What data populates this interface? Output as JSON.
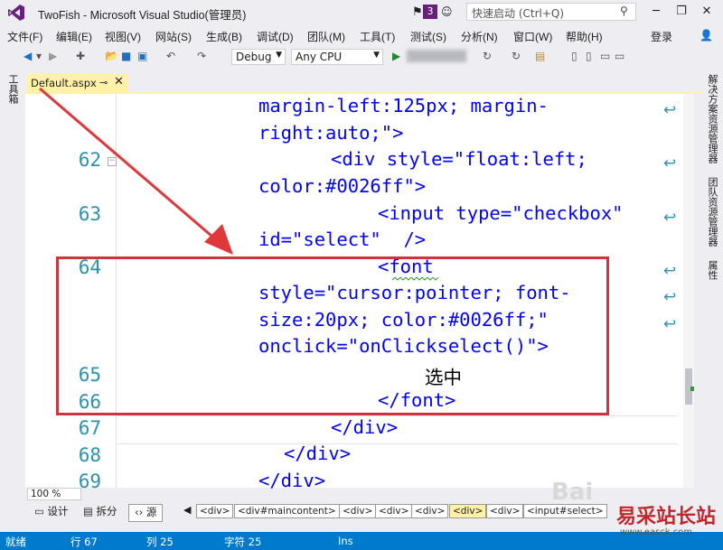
{
  "window": {
    "title": "TwoFish - Microsoft Visual Studio(管理员)",
    "notification_count": "3",
    "quick_launch_placeholder": "快速启动 (Ctrl+Q)",
    "login": "登录",
    "controls": [
      "─",
      "❐",
      "✕"
    ]
  },
  "menu": [
    "文件(F)",
    "编辑(E)",
    "视图(V)",
    "网站(S)",
    "生成(B)",
    "调试(D)",
    "团队(M)",
    "工具(T)",
    "测试(S)",
    "分析(N)",
    "窗口(W)",
    "帮助(H)"
  ],
  "toolbar": {
    "config": "Debug",
    "platform": "Any CPU"
  },
  "left_panel": {
    "toolbox": "工具箱"
  },
  "right_panel": [
    "解决方案资源管理器",
    "团队资源管理器",
    "属性"
  ],
  "document_tab": {
    "label": "Default.aspx",
    "pin": "ᵖ",
    "close": "✕"
  },
  "editor": {
    "lines": [
      {
        "num": "",
        "text": "margin-left:125px; margin-"
      },
      {
        "num": "",
        "text": "right:auto;\">"
      },
      {
        "num": "62",
        "text": "<div style=\"float:left;"
      },
      {
        "num": "",
        "text": "color:#0026ff\">"
      },
      {
        "num": "63",
        "text": "<input type=\"checkbox\""
      },
      {
        "num": "",
        "text": "id=\"select\"  />"
      },
      {
        "num": "64",
        "text": "<font"
      },
      {
        "num": "",
        "text": "style=\"cursor:pointer; font-"
      },
      {
        "num": "",
        "text": "size:20px; color:#0026ff;\""
      },
      {
        "num": "",
        "text": "onclick=\"onClickselect()\">"
      },
      {
        "num": "65",
        "text": "选中"
      },
      {
        "num": "66",
        "text": "</font>"
      },
      {
        "num": "67",
        "text": "</div>"
      },
      {
        "num": "68",
        "text": "</div>"
      },
      {
        "num": "69",
        "text": "</div>"
      }
    ]
  },
  "bottom": {
    "zoom": "100 %",
    "views": [
      "设计",
      "拆分",
      "源"
    ],
    "breadcrumbs": [
      "<div>",
      "<div#maincontent>",
      "<div>",
      "<div>",
      "<div>",
      "<div>",
      "<div>",
      "<input#select>"
    ]
  },
  "status": {
    "ready": "就绪",
    "row": "行 67",
    "col": "列 25",
    "char": "字符 25",
    "mode": "Ins"
  },
  "watermark": {
    "brand": "易采站长站",
    "url": "www.easck.com"
  }
}
